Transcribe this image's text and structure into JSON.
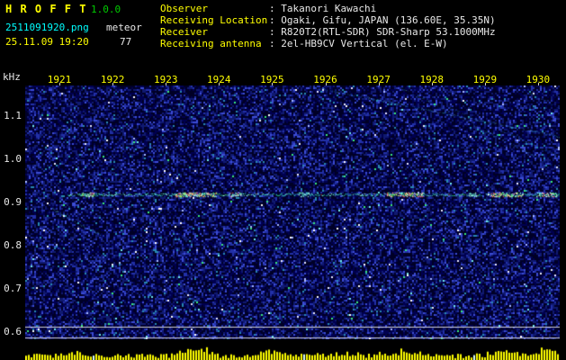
{
  "header": {
    "app_title": "H R O F F T",
    "version": "1.0.0",
    "filename": "2511091920.png",
    "mode": "meteor",
    "datetime": "25.11.09 19:20",
    "count": "77",
    "info_rows": [
      {
        "label": "Observer",
        "value": ": Takanori Kawachi"
      },
      {
        "label": "Receiving Location",
        "value": ": Ogaki, Gifu, JAPAN (136.60E, 35.35N)"
      },
      {
        "label": "Receiver",
        "value": ": R820T2(RTL-SDR) SDR-Sharp 53.1000MHz"
      },
      {
        "label": "Receiving antenna",
        "value": ": 2el-HB9CV Vertical (el. E-W)"
      }
    ]
  },
  "colors": {
    "title_yellow": "#ffff00",
    "version_green": "#00cc00",
    "filename_cyan": "#00ffff",
    "label_yellow": "#ffff00",
    "value_white": "#e8e8e8",
    "axis_time_yellow": "#ffff00",
    "axis_freq_white": "#e8e8e8",
    "noise_blue": "#2230a8",
    "echo_cyan": "#58e8cc",
    "echo_red": "#ff4848",
    "level_bar_yellow": "#ffff00"
  },
  "chart_data": {
    "type": "heatmap",
    "title": "HROFFT 10-minute meteor radio echo spectrogram",
    "x_tick_labels": [
      "1921",
      "1922",
      "1923",
      "1924",
      "1925",
      "1926",
      "1927",
      "1928",
      "1929",
      "1930"
    ],
    "x_range_time": [
      1920.36,
      1930.41
    ],
    "y_axis_unit": "kHz",
    "y_tick_labels": [
      "1.1",
      "1.0",
      "0.9",
      "0.8",
      "0.7",
      "0.6"
    ],
    "y_tick_values_khz": [
      1.1,
      1.0,
      0.9,
      0.8,
      0.7,
      0.6
    ],
    "y_range_khz": [
      1.172,
      0.582
    ],
    "grid": false,
    "legend": false,
    "noise_seed": 1337,
    "carrier": {
      "freq_khz": 0.92,
      "t_start": 1921.15,
      "t_end": 1930.41,
      "bursts": [
        {
          "t1": 1921.42,
          "t2": 1921.65,
          "level": 2
        },
        {
          "t1": 1923.18,
          "t2": 1923.95,
          "level": 3
        },
        {
          "t1": 1924.22,
          "t2": 1924.42,
          "level": 2
        },
        {
          "t1": 1925.5,
          "t2": 1925.7,
          "level": 1
        },
        {
          "t1": 1927.16,
          "t2": 1927.85,
          "level": 3
        },
        {
          "t1": 1928.7,
          "t2": 1928.85,
          "level": 1
        },
        {
          "t1": 1929.12,
          "t2": 1929.72,
          "level": 3
        },
        {
          "t1": 1929.97,
          "t2": 1930.35,
          "level": 2
        }
      ]
    },
    "aircraft_traces": [
      {
        "t1": 1925.81,
        "f1": 1.168,
        "t2": 1930.41,
        "f2": 1.054,
        "alpha": 0.55
      },
      {
        "t1": 1927.41,
        "f1": 1.168,
        "t2": 1930.41,
        "f2": 0.979,
        "alpha": 0.35
      },
      {
        "t1": 1928.34,
        "f1": 1.121,
        "t2": 1930.41,
        "f2": 1.008,
        "alpha": 0.3
      },
      {
        "t1": 1929.78,
        "f1": 1.158,
        "t2": 1930.41,
        "f2": 1.121,
        "alpha": 0.3
      }
    ],
    "meteor_trail": {
      "points": [
        [
          1920.85,
          0.888
        ],
        [
          1921.33,
          0.854
        ],
        [
          1921.78,
          0.827
        ]
      ],
      "alpha": 0.5
    },
    "reference_lines_khz": [
      0.613,
      0.588
    ],
    "level_bars": {
      "seed": 4242,
      "peaks": [
        {
          "t": 1921.25,
          "boost": 5
        },
        {
          "t": 1923.55,
          "boost": 11
        },
        {
          "t": 1924.95,
          "boost": 6
        },
        {
          "t": 1926.3,
          "boost": 3
        },
        {
          "t": 1927.5,
          "boost": 4
        },
        {
          "t": 1929.35,
          "boost": 7
        },
        {
          "t": 1930.15,
          "boost": 7
        }
      ]
    }
  }
}
